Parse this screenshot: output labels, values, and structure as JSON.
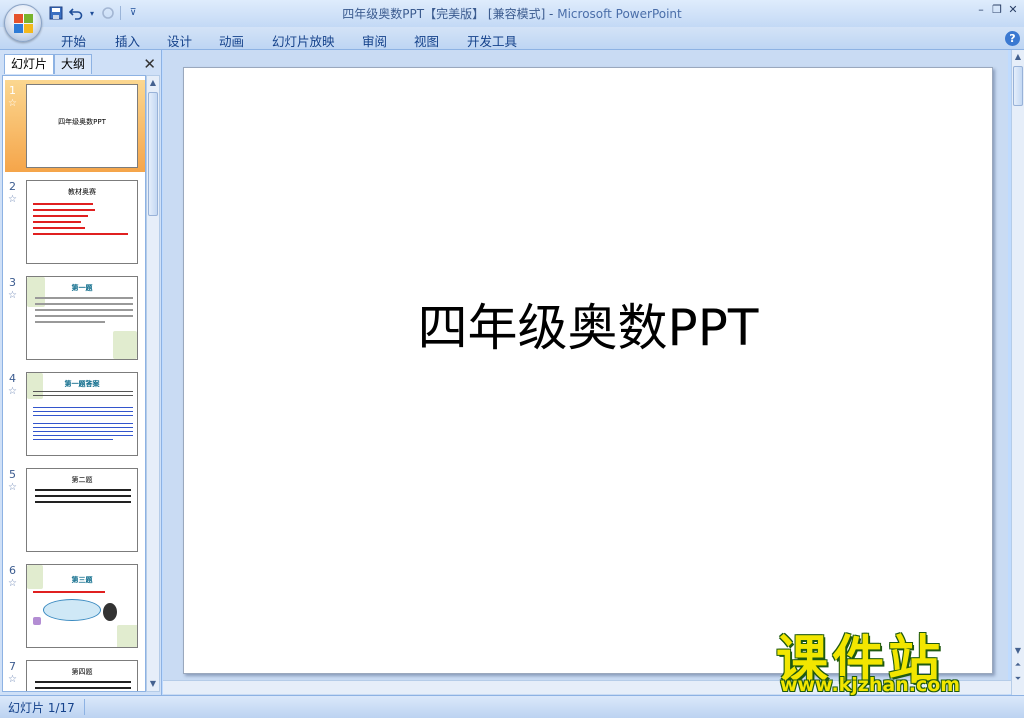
{
  "window": {
    "title": "四年级奥数PPT【完美版】 [兼容模式] -",
    "app_name": "Microsoft PowerPoint",
    "controls": [
      "minimize-icon",
      "restore-icon",
      "close-icon"
    ]
  },
  "quick_access": [
    "save-icon",
    "undo-icon",
    "redo-icon",
    "customize-icon"
  ],
  "ribbon": {
    "tabs": [
      "开始",
      "插入",
      "设计",
      "动画",
      "幻灯片放映",
      "审阅",
      "视图",
      "开发工具"
    ],
    "help_label": "?"
  },
  "left_panel": {
    "tab_slides": "幻灯片",
    "tab_outline": "大纲",
    "close_label": "✕",
    "thumbnails": [
      {
        "number": "1",
        "title": "四年级奥数PPT",
        "selected": true
      },
      {
        "number": "2",
        "title": "教材奥赛"
      },
      {
        "number": "3",
        "title": "第一题"
      },
      {
        "number": "4",
        "title": "第一题答案"
      },
      {
        "number": "5",
        "title": "第二题"
      },
      {
        "number": "6",
        "title": "第三题"
      },
      {
        "number": "7",
        "title": "第四题"
      }
    ]
  },
  "slide": {
    "title": "四年级奥数PPT"
  },
  "status": {
    "slide_indicator": "幻灯片 1/17"
  },
  "watermark": {
    "name": "课件站",
    "url": "www.kjzhan.com"
  },
  "colors": {
    "ribbon_bg": "#bfdbff",
    "selection": "#f5a54a",
    "watermark_fill": "#f2e600"
  }
}
